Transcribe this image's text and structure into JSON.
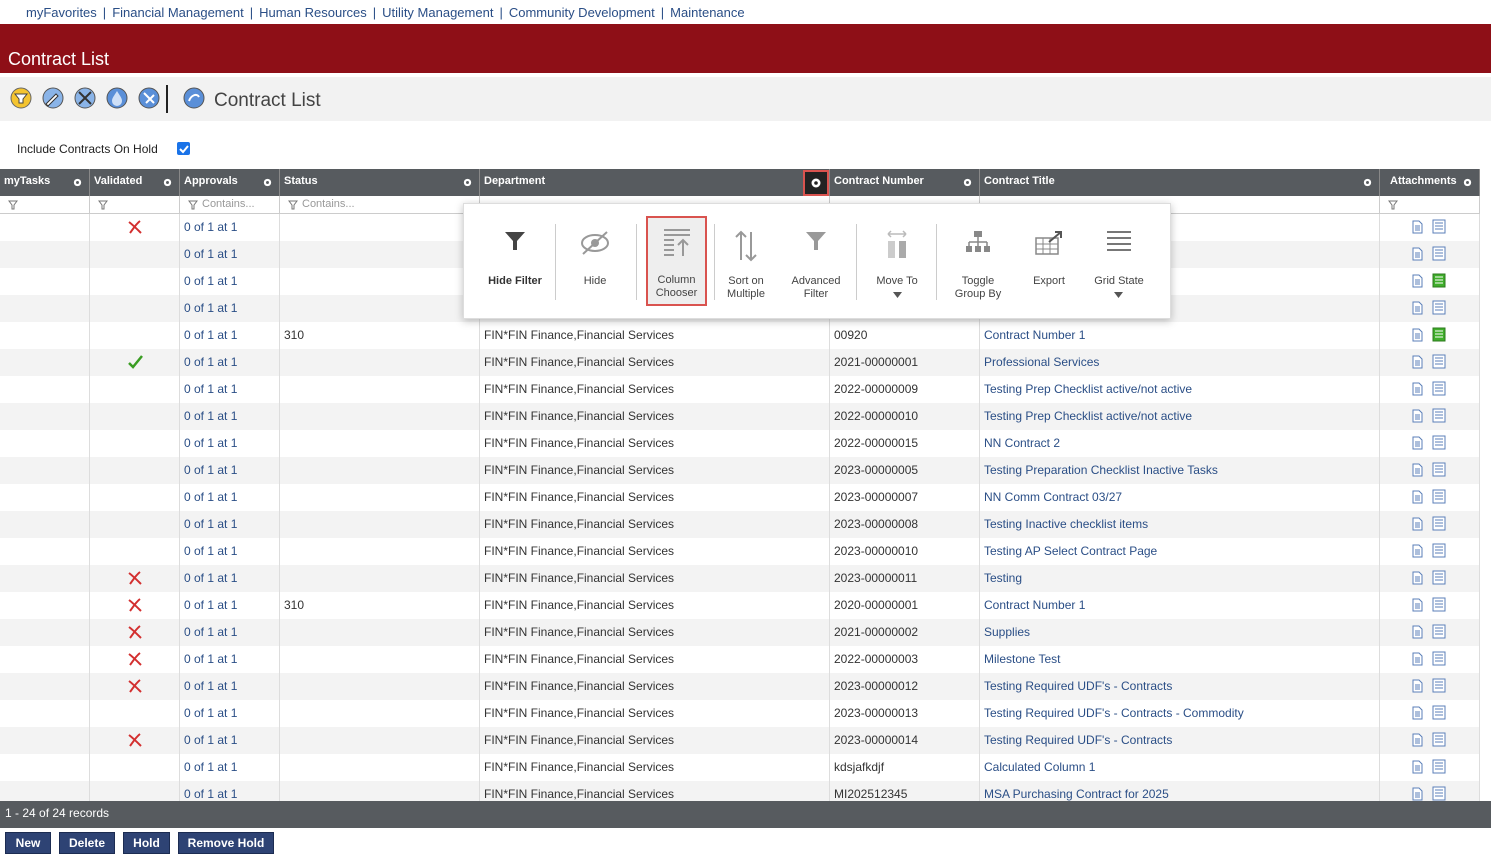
{
  "nav": [
    "myFavorites",
    "Financial Management",
    "Human Resources",
    "Utility Management",
    "Community Development",
    "Maintenance"
  ],
  "banner_title": "Contract List",
  "page_heading": "Contract List",
  "hold_label": "Include Contracts On Hold",
  "columns": [
    "myTasks",
    "Validated",
    "Approvals",
    "Status",
    "Department",
    "Contract Number",
    "Contract Title",
    "Attachments"
  ],
  "filter_placeholder": "Contains...",
  "rows": [
    {
      "validated": "x",
      "approvals": "0 of 1 at 1",
      "status": "",
      "dept": "",
      "number": "",
      "title": "",
      "a2green": false
    },
    {
      "validated": "",
      "approvals": "0 of 1 at 1",
      "status": "",
      "dept": "",
      "number": "",
      "title": "",
      "a2green": false
    },
    {
      "validated": "",
      "approvals": "0 of 1 at 1",
      "status": "",
      "dept": "",
      "number": "",
      "title": "",
      "a2green": true
    },
    {
      "validated": "",
      "approvals": "0 of 1 at 1",
      "status": "",
      "dept": "",
      "number": "",
      "title": "",
      "a2green": false
    },
    {
      "validated": "",
      "approvals": "0 of 1 at 1",
      "status": "310",
      "dept": "FIN*FIN Finance,Financial Services",
      "number": "00920",
      "title": "Contract Number 1",
      "a2green": true
    },
    {
      "validated": "check",
      "approvals": "0 of 1 at 1",
      "status": "",
      "dept": "FIN*FIN Finance,Financial Services",
      "number": "2021-00000001",
      "title": "Professional Services",
      "a2green": false
    },
    {
      "validated": "",
      "approvals": "0 of 1 at 1",
      "status": "",
      "dept": "FIN*FIN Finance,Financial Services",
      "number": "2022-00000009",
      "title": "Testing Prep Checklist active/not active",
      "a2green": false
    },
    {
      "validated": "",
      "approvals": "0 of 1 at 1",
      "status": "",
      "dept": "FIN*FIN Finance,Financial Services",
      "number": "2022-00000010",
      "title": "Testing Prep Checklist active/not active",
      "a2green": false
    },
    {
      "validated": "",
      "approvals": "0 of 1 at 1",
      "status": "",
      "dept": "FIN*FIN Finance,Financial Services",
      "number": "2022-00000015",
      "title": "NN Contract 2",
      "a2green": false
    },
    {
      "validated": "",
      "approvals": "0 of 1 at 1",
      "status": "",
      "dept": "FIN*FIN Finance,Financial Services",
      "number": "2023-00000005",
      "title": "Testing Preparation Checklist Inactive Tasks",
      "a2green": false
    },
    {
      "validated": "",
      "approvals": "0 of 1 at 1",
      "status": "",
      "dept": "FIN*FIN Finance,Financial Services",
      "number": "2023-00000007",
      "title": "NN Comm Contract 03/27",
      "a2green": false
    },
    {
      "validated": "",
      "approvals": "0 of 1 at 1",
      "status": "",
      "dept": "FIN*FIN Finance,Financial Services",
      "number": "2023-00000008",
      "title": "Testing Inactive checklist items",
      "a2green": false
    },
    {
      "validated": "",
      "approvals": "0 of 1 at 1",
      "status": "",
      "dept": "FIN*FIN Finance,Financial Services",
      "number": "2023-00000010",
      "title": "Testing AP Select Contract Page",
      "a2green": false
    },
    {
      "validated": "x",
      "approvals": "0 of 1 at 1",
      "status": "",
      "dept": "FIN*FIN Finance,Financial Services",
      "number": "2023-00000011",
      "title": "Testing",
      "a2green": false
    },
    {
      "validated": "x",
      "approvals": "0 of 1 at 1",
      "status": "310",
      "dept": "FIN*FIN Finance,Financial Services",
      "number": "2020-00000001",
      "title": "Contract Number 1",
      "a2green": false
    },
    {
      "validated": "x",
      "approvals": "0 of 1 at 1",
      "status": "",
      "dept": "FIN*FIN Finance,Financial Services",
      "number": "2021-00000002",
      "title": "Supplies",
      "a2green": false
    },
    {
      "validated": "x",
      "approvals": "0 of 1 at 1",
      "status": "",
      "dept": "FIN*FIN Finance,Financial Services",
      "number": "2022-00000003",
      "title": "Milestone Test",
      "a2green": false
    },
    {
      "validated": "x",
      "approvals": "0 of 1 at 1",
      "status": "",
      "dept": "FIN*FIN Finance,Financial Services",
      "number": "2023-00000012",
      "title": "Testing Required UDF's - Contracts",
      "a2green": false
    },
    {
      "validated": "",
      "approvals": "0 of 1 at 1",
      "status": "",
      "dept": "FIN*FIN Finance,Financial Services",
      "number": "2023-00000013",
      "title": "Testing Required UDF's - Contracts - Commodity",
      "a2green": false
    },
    {
      "validated": "x",
      "approvals": "0 of 1 at 1",
      "status": "",
      "dept": "FIN*FIN Finance,Financial Services",
      "number": "2023-00000014",
      "title": "Testing Required UDF's - Contracts",
      "a2green": false
    },
    {
      "validated": "",
      "approvals": "0 of 1 at 1",
      "status": "",
      "dept": "FIN*FIN Finance,Financial Services",
      "number": "kdsjafkdjf",
      "title": "Calculated Column 1",
      "a2green": false
    },
    {
      "validated": "",
      "approvals": "0 of 1 at 1",
      "status": "",
      "dept": "FIN*FIN Finance,Financial Services",
      "number": "MI202512345",
      "title": "MSA Purchasing Contract for 2025",
      "a2green": false
    }
  ],
  "footer_text": "1 - 24 of 24 records",
  "buttons": [
    "New",
    "Delete",
    "Hold",
    "Remove Hold"
  ],
  "popup": {
    "hide_filter": "Hide Filter",
    "hide": "Hide",
    "column_chooser": [
      "Column",
      "Chooser"
    ],
    "sort_multiple": [
      "Sort on",
      "Multiple"
    ],
    "advanced_filter": [
      "Advanced",
      "Filter"
    ],
    "move_to": "Move To",
    "toggle_group": [
      "Toggle",
      "Group By"
    ],
    "export": "Export",
    "grid_state": "Grid State"
  },
  "colors": {
    "banner": "#8e0f17",
    "header": "#575b5f",
    "link": "#2a4e86",
    "button": "#2e4374",
    "highlight": "#d9534f"
  }
}
